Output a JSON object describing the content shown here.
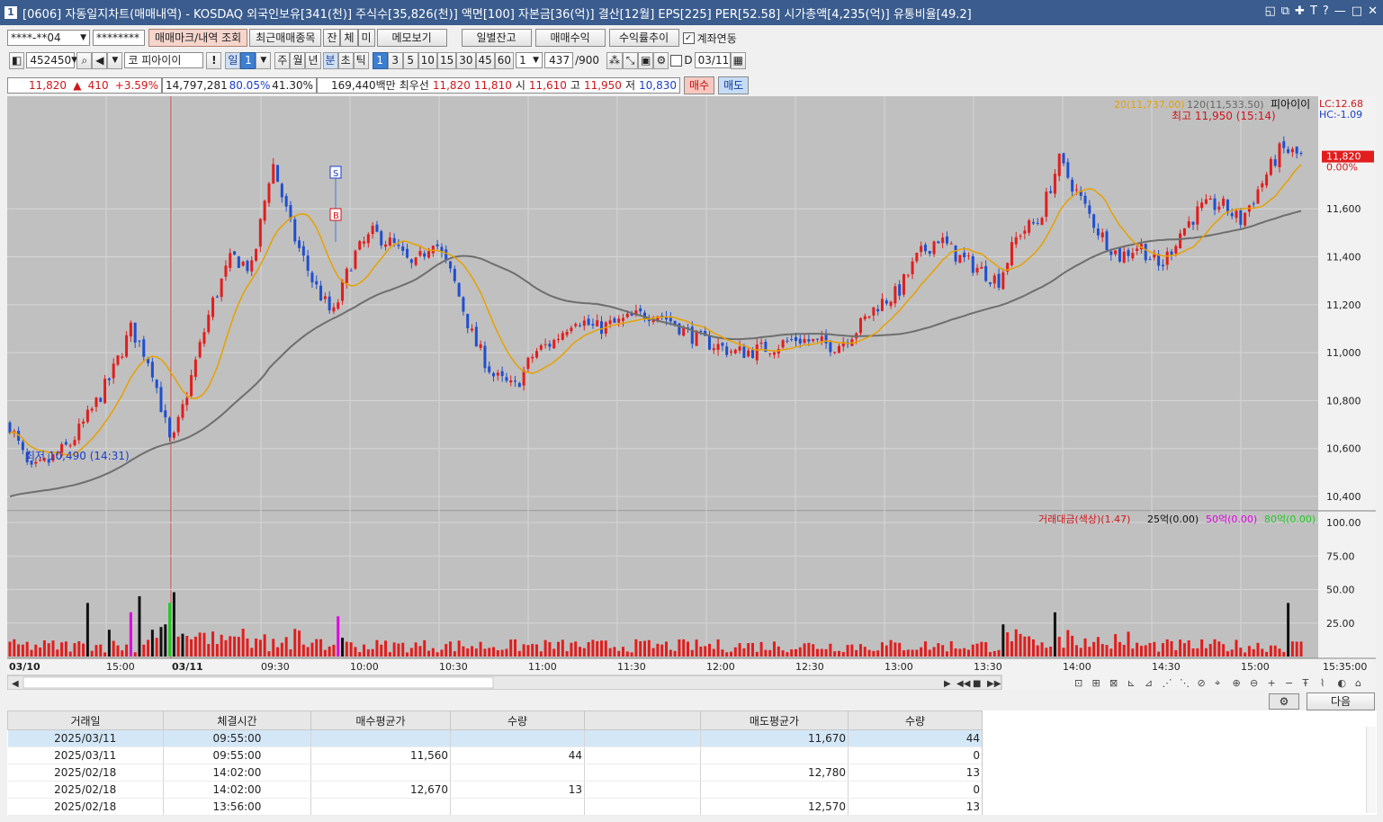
{
  "window": {
    "title": "[0606] 자동일지차트(매매내역) - KOSDAQ 외국인보유[341(천)] 주식수[35,826(천)] 액면[100] 자본금[36(억)] 결산[12월] EPS[225] PER[52.58] 시가총액[4,235(억)] 유통비율[49.2]"
  },
  "toolbar1": {
    "account": "****-**04",
    "password": "********",
    "btn_trade_marks": "매매마크/내역 조회",
    "btn_recent": "최근매매종목",
    "btn_jan": "잔",
    "btn_che": "체",
    "btn_mi": "미",
    "btn_memo": "메모보기",
    "btn_daily": "일별잔고",
    "btn_trade_profit": "매매수익",
    "btn_return": "수익률추이",
    "account_link_label": "계좌연동",
    "account_link_checked": true
  },
  "toolbar2": {
    "code": "452450",
    "market": "코",
    "name": "피아이이",
    "excl": "!",
    "day": "일",
    "day_n": "1",
    "week": "주",
    "month": "월",
    "year": "년",
    "minute": "분",
    "second": "초",
    "tick": "틱",
    "periods": [
      "1",
      "3",
      "5",
      "10",
      "15",
      "30",
      "45",
      "60"
    ],
    "selected_period": "1",
    "count_sel": "1",
    "count": "437",
    "total": "/900",
    "d_label": "D",
    "date": "03/11"
  },
  "quote": {
    "price": "11,820",
    "arrow": "▲",
    "change": "410",
    "pct": "+3.59%",
    "volume": "14,797,281",
    "ratio1": "80.05%",
    "ratio2": "41.30%",
    "amount": "169,440백만",
    "best_label": "최우선",
    "ask": "11,820",
    "bid": "11,810",
    "open_label": "시",
    "open": "11,610",
    "high_label": "고",
    "high": "11,950",
    "low_label": "저",
    "low": "10,830",
    "buy": "매수",
    "sell": "매도"
  },
  "chart_data": [
    {
      "type": "candlestick",
      "title": "",
      "ma_labels": {
        "ma20": "20(11,737.00)",
        "ma120": "120(11,533.50)",
        "name": "피아이이"
      },
      "lc": "LC:12.68",
      "hc": "HC:-1.09",
      "current_price": "11,820",
      "current_pct": "0.00%",
      "high_annot": "최고 11,950 (15:14)",
      "low_annot": "최저 10,490 (14:31)",
      "y_ticks": [
        "11,600",
        "11,400",
        "11,200",
        "11,000",
        "10,800",
        "10,600",
        "10,400"
      ],
      "ylim": [
        10340,
        12070
      ],
      "x_ticks": [
        "03/10",
        "15:00",
        "03/11",
        "09:30",
        "10:00",
        "10:30",
        "11:00",
        "11:30",
        "12:00",
        "12:30",
        "13:00",
        "13:30",
        "14:00",
        "14:30",
        "15:00",
        "15:35:00"
      ],
      "trade_marks": [
        {
          "label": "S",
          "type": "sell"
        },
        {
          "label": "B",
          "type": "buy"
        }
      ],
      "price_path": [
        10700,
        10500,
        10550,
        10620,
        10750,
        10900,
        11100,
        10950,
        10600,
        10900,
        11200,
        11400,
        11350,
        11800,
        11500,
        11300,
        11150,
        11400,
        11500,
        11450,
        11350,
        11480,
        11300,
        11050,
        10900,
        10850,
        11000,
        11050,
        11150,
        11100,
        11120,
        11150,
        11170,
        11120,
        11060,
        11030,
        11000,
        11010,
        11030,
        11060,
        11040,
        11030,
        11100,
        11200,
        11250,
        11400,
        11480,
        11400,
        11350,
        11300,
        11500,
        11550,
        11800,
        11650,
        11500,
        11400,
        11450,
        11350,
        11500,
        11600,
        11620,
        11550,
        11700,
        11850,
        11820
      ]
    },
    {
      "type": "bar",
      "title": "거래대금(색상)(1.47)",
      "legend": [
        {
          "name": "25억(0.00)",
          "color": "#111111"
        },
        {
          "name": "50억(0.00)",
          "color": "#e000e0"
        },
        {
          "name": "80억(0.00)",
          "color": "#22c922"
        }
      ],
      "y_ticks": [
        "100.00",
        "75.00",
        "50.00",
        "25.00"
      ],
      "ylim": [
        0,
        100
      ]
    }
  ],
  "nav": {
    "next": "다음"
  },
  "table": {
    "headers": [
      "거래일",
      "체결시간",
      "매수평균가",
      "수량",
      "",
      "매도평균가",
      "수량"
    ],
    "rows": [
      [
        "2025/03/11",
        "09:55:00",
        "",
        "",
        "",
        "11,670",
        "44"
      ],
      [
        "2025/03/11",
        "09:55:00",
        "11,560",
        "44",
        "",
        "",
        "0"
      ],
      [
        "2025/02/18",
        "14:02:00",
        "",
        "",
        "",
        "12,780",
        "13"
      ],
      [
        "2025/02/18",
        "14:02:00",
        "12,670",
        "13",
        "",
        "",
        "0"
      ],
      [
        "2025/02/18",
        "13:56:00",
        "",
        "",
        "",
        "12,570",
        "13"
      ]
    ]
  }
}
